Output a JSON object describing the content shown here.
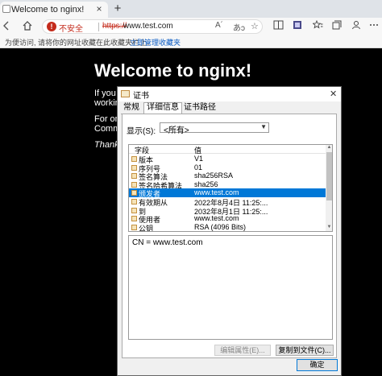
{
  "browser": {
    "tab": {
      "title": "Welcome to nginx!",
      "close_glyph": "×"
    },
    "new_tab_glyph": "+",
    "icons": {
      "back": "back-arrow-icon",
      "home": "home-icon",
      "warning": "warning-icon",
      "read_aloud": "read-aloud-icon",
      "translate": "translate-icon",
      "favorite": "favorite-star-icon",
      "split_screen": "split-screen-icon",
      "favorites": "favorites-icon",
      "collections": "collections-icon"
    },
    "address": {
      "security_label": "不安全",
      "scheme": "https://",
      "rest": "www.test.com",
      "read_aloud_glyph": "A´",
      "translate_glyph": "あɔ",
      "favorite_glyph": "☆"
    },
    "favbar": {
      "hint": "为便访问, 请将你的网址收藏在此收藏夹栏上。",
      "link": "立即管理收藏夹"
    }
  },
  "page": {
    "title": "Welcome to nginx!",
    "lines": [
      "If you",
      "working",
      "For onl",
      "Comme",
      "Thank"
    ]
  },
  "cert_dialog": {
    "title": "证书",
    "close_glyph": "✕",
    "tabs": [
      "常规",
      "详细信息",
      "证书路径"
    ],
    "active_tab": "详细信息",
    "show_label": "显示(S):",
    "show_value": "<所有>",
    "list_header": {
      "field": "字段",
      "value": "值"
    },
    "fields": [
      {
        "name": "版本",
        "value": "V1"
      },
      {
        "name": "序列号",
        "value": "01"
      },
      {
        "name": "签名算法",
        "value": "sha256RSA"
      },
      {
        "name": "签名哈希算法",
        "value": "sha256"
      },
      {
        "name": "颁发者",
        "value": "www.test.com",
        "selected": true
      },
      {
        "name": "有效期从",
        "value": "2022年8月4日 11:25:..."
      },
      {
        "name": "到",
        "value": "2032年8月1日 11:25:..."
      },
      {
        "name": "使用者",
        "value": "www.test.com"
      },
      {
        "name": "公钥",
        "value": "RSA (4096 Bits)"
      }
    ],
    "value_text": "CN = www.test.com",
    "edit_properties_button": "编辑属性(E)...",
    "copy_to_file_button": "复制到文件(C)...",
    "ok_button": "确定"
  }
}
